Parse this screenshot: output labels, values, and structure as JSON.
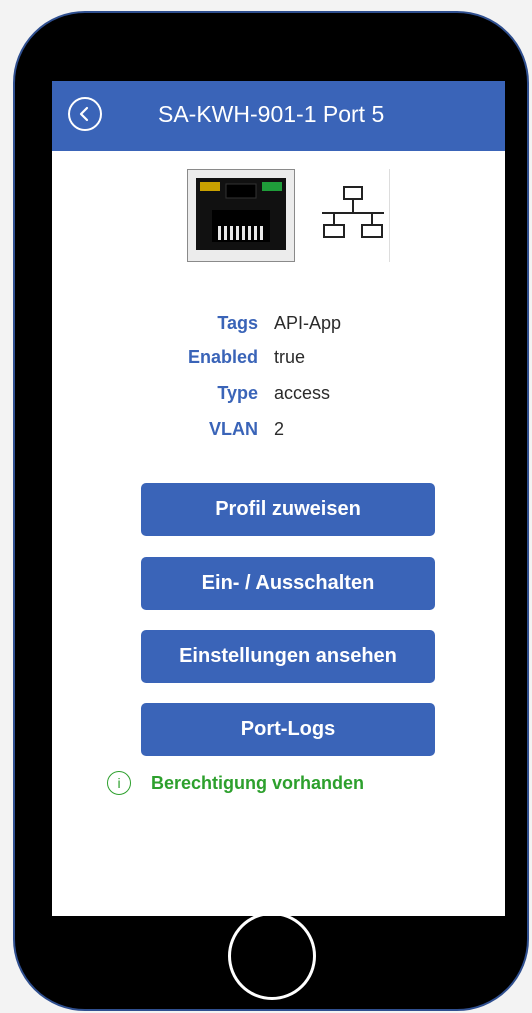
{
  "header": {
    "title": "SA-KWH-901-1 Port 5"
  },
  "port": {
    "icon": "ethernet-port-icon",
    "network_icon": "network-topology-icon",
    "led_left_color": "#c8a000",
    "led_right_color": "#1f9d3a"
  },
  "info": [
    {
      "label": "Tags",
      "value": "API-App"
    },
    {
      "label": "Enabled",
      "value": "true"
    },
    {
      "label": "Type",
      "value": "access"
    },
    {
      "label": "VLAN",
      "value": "2"
    }
  ],
  "actions": [
    {
      "label": "Profil zuweisen"
    },
    {
      "label": "Ein- / Ausschalten"
    },
    {
      "label": "Einstellungen ansehen"
    },
    {
      "label": "Port-Logs"
    }
  ],
  "status": {
    "text": "Berechtigung vorhanden",
    "icon": "info-icon",
    "color": "#2da02d"
  },
  "colors": {
    "accent": "#3a64b8",
    "frame": "#000000"
  }
}
